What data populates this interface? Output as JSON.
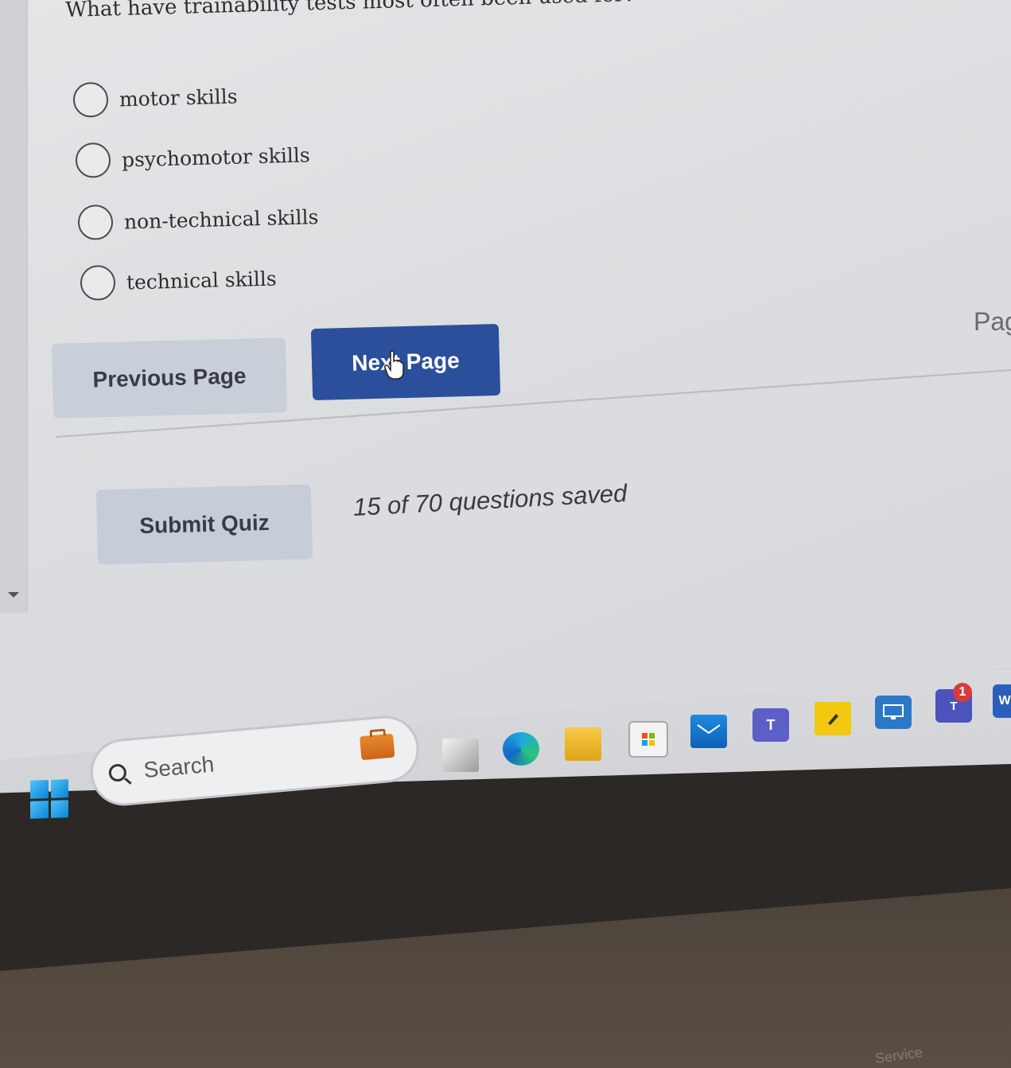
{
  "quiz": {
    "question": "What have trainability tests most often been used for?",
    "options": [
      {
        "label": "motor skills",
        "selected": false
      },
      {
        "label": "psychomotor skills",
        "selected": false
      },
      {
        "label": "non-technical skills",
        "selected": false
      },
      {
        "label": "technical skills",
        "selected": false
      }
    ],
    "prev_button": "Previous Page",
    "next_button": "Next Page",
    "submit_button": "Submit Quiz",
    "saved_status": "15 of 70 questions saved",
    "page_label_partial": "Pag"
  },
  "taskbar": {
    "search_placeholder": "Search",
    "icons": [
      "briefcase-icon",
      "task-view-icon",
      "edge-icon",
      "file-explorer-icon",
      "store-icon",
      "mail-icon",
      "teams-icon",
      "sticky-notes-icon",
      "remote-desktop-icon",
      "teams-new-icon",
      "word-icon"
    ],
    "teams_new_label": "T",
    "teams_new_badge": "1",
    "word_label": "W",
    "teams_label": "T"
  },
  "device": {
    "label": "Service"
  },
  "colors": {
    "primary_button": "#2c4f9b",
    "secondary_button": "#c9cfd8",
    "page_bg": "#e0e1e4",
    "taskbar_bg": "#d6d7da",
    "badge": "#d83b3b"
  }
}
